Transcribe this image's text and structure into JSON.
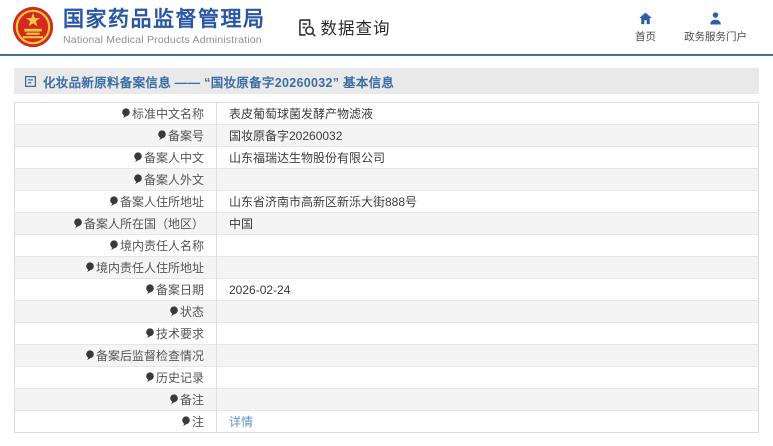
{
  "header": {
    "agency_title": "国家药品监督管理局",
    "agency_subtitle": "National Medical Products Administration",
    "query_label": "数据查询",
    "home_label": "首页",
    "portal_label": "政务服务门户"
  },
  "page": {
    "section_title": "化妆品新原料备案信息 —— “国妆原备字20260032” 基本信息"
  },
  "detail_table": {
    "rows": [
      {
        "label": "标准中文名称",
        "value": "表皮葡萄球菌发酵产物滤液"
      },
      {
        "label": "备案号",
        "value": "国妆原备字20260032"
      },
      {
        "label": "备案人中文",
        "value": "山东福瑞达生物股份有限公司"
      },
      {
        "label": "备案人外文",
        "value": ""
      },
      {
        "label": "备案人住所地址",
        "value": "山东省济南市高新区新泺大街888号"
      },
      {
        "label": "备案人所在国（地区）",
        "value": "中国"
      },
      {
        "label": "境内责任人名称",
        "value": ""
      },
      {
        "label": "境内责任人住所地址",
        "value": ""
      },
      {
        "label": "备案日期",
        "value": "2026-02-24"
      },
      {
        "label": "状态",
        "value": ""
      },
      {
        "label": "技术要求",
        "value": ""
      },
      {
        "label": "备案后监督检查情况",
        "value": ""
      },
      {
        "label": "历史记录",
        "value": ""
      },
      {
        "label": "备注",
        "value": ""
      },
      {
        "label": "注",
        "value": "详情",
        "value_link": true,
        "label_icon": "note-icon"
      }
    ]
  },
  "colors": {
    "brand_blue": "#2957a4",
    "nav_icon_blue": "#2e5fa3",
    "link_blue": "#5f94c5",
    "header_divider": "#47718e",
    "section_bar_bg": "#e9e9e9",
    "emblem_red": "#d5281e",
    "emblem_gold": "#f5c843"
  }
}
